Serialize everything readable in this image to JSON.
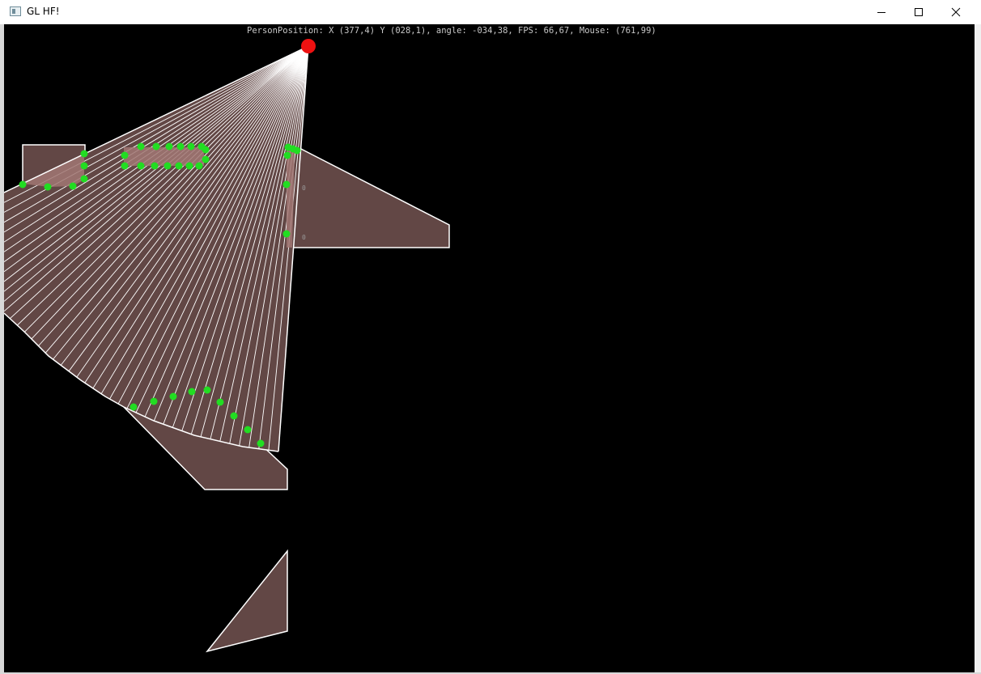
{
  "window": {
    "title": "GL HF!",
    "minimize_label": "Minimize",
    "maximize_label": "Maximize",
    "close_label": "Close"
  },
  "hud": {
    "status_line": "PersonPosition: X (377,4) Y (028,1), angle: -034,38, FPS: 66,67, Mouse: (761,99)"
  },
  "colors": {
    "background": "#000000",
    "obstacle_fill": "#624745",
    "visible_fill": "#a17773",
    "outline": "#ffffff",
    "node": "#22dd22",
    "person": "#ee1111"
  },
  "scene_labels": {
    "near_label": "0"
  }
}
